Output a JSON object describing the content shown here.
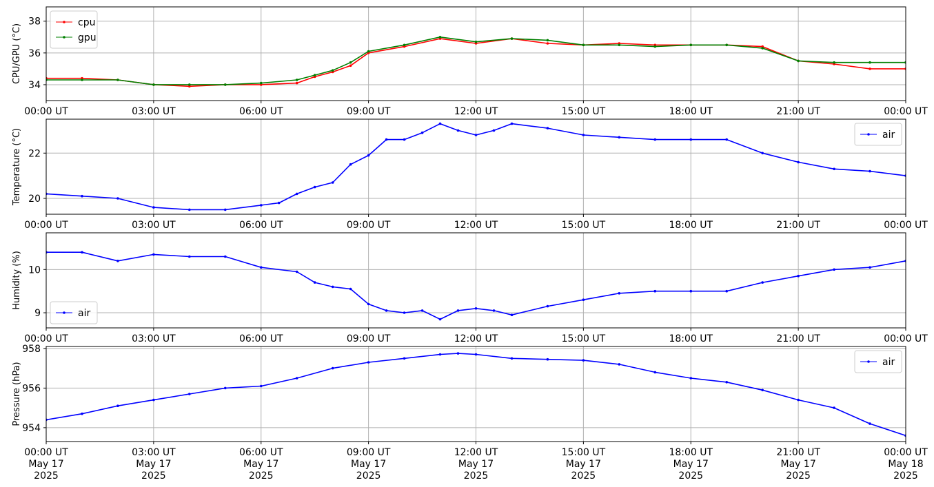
{
  "x_ticks": [
    {
      "time": "00:00 UT",
      "month_day": "May 17",
      "year": "2025"
    },
    {
      "time": "03:00 UT",
      "month_day": "May 17",
      "year": "2025"
    },
    {
      "time": "06:00 UT",
      "month_day": "May 17",
      "year": "2025"
    },
    {
      "time": "09:00 UT",
      "month_day": "May 17",
      "year": "2025"
    },
    {
      "time": "12:00 UT",
      "month_day": "May 17",
      "year": "2025"
    },
    {
      "time": "15:00 UT",
      "month_day": "May 17",
      "year": "2025"
    },
    {
      "time": "18:00 UT",
      "month_day": "May 17",
      "year": "2025"
    },
    {
      "time": "21:00 UT",
      "month_day": "May 17",
      "year": "2025"
    },
    {
      "time": "00:00 UT",
      "month_day": "May 18",
      "year": "2025"
    }
  ],
  "colors": {
    "cpu": "#ff0000",
    "gpu": "#008000",
    "air": "#0000ff"
  },
  "chart_data": [
    {
      "type": "line",
      "ylabel": "CPU/GPU (°C)",
      "ylim": [
        33.0,
        38.9
      ],
      "yticks": [
        34,
        36,
        38
      ],
      "xlim": [
        "2025-05-17 00:00",
        "2025-05-18 00:00"
      ],
      "grid": true,
      "legend": "top-left",
      "x": [
        "2025-05-17 00:00",
        "2025-05-17 01:00",
        "2025-05-17 02:00",
        "2025-05-17 03:00",
        "2025-05-17 04:00",
        "2025-05-17 05:00",
        "2025-05-17 06:00",
        "2025-05-17 07:00",
        "2025-05-17 07:30",
        "2025-05-17 08:00",
        "2025-05-17 08:30",
        "2025-05-17 09:00",
        "2025-05-17 10:00",
        "2025-05-17 11:00",
        "2025-05-17 12:00",
        "2025-05-17 13:00",
        "2025-05-17 14:00",
        "2025-05-17 15:00",
        "2025-05-17 16:00",
        "2025-05-17 17:00",
        "2025-05-17 18:00",
        "2025-05-17 19:00",
        "2025-05-17 20:00",
        "2025-05-17 21:00",
        "2025-05-17 22:00",
        "2025-05-17 23:00",
        "2025-05-18 00:00"
      ],
      "series": [
        {
          "name": "cpu",
          "color": "#ff0000",
          "values": [
            34.4,
            34.4,
            34.3,
            34.0,
            33.9,
            34.0,
            34.0,
            34.1,
            34.5,
            34.8,
            35.2,
            36.0,
            36.4,
            36.9,
            36.6,
            36.9,
            36.6,
            36.5,
            36.6,
            36.5,
            36.5,
            36.5,
            36.4,
            35.5,
            35.3,
            35.0,
            35.0
          ]
        },
        {
          "name": "gpu",
          "color": "#008000",
          "values": [
            34.3,
            34.3,
            34.3,
            34.0,
            34.0,
            34.0,
            34.1,
            34.3,
            34.6,
            34.9,
            35.4,
            36.1,
            36.5,
            37.0,
            36.7,
            36.9,
            36.8,
            36.5,
            36.5,
            36.4,
            36.5,
            36.5,
            36.3,
            35.5,
            35.4,
            35.4,
            35.4
          ]
        }
      ]
    },
    {
      "type": "line",
      "ylabel": "Temperature (°C)",
      "ylim": [
        19.3,
        23.5
      ],
      "yticks": [
        20,
        22
      ],
      "xlim": [
        "2025-05-17 00:00",
        "2025-05-18 00:00"
      ],
      "grid": true,
      "legend": "top-right",
      "x": [
        "2025-05-17 00:00",
        "2025-05-17 01:00",
        "2025-05-17 02:00",
        "2025-05-17 03:00",
        "2025-05-17 04:00",
        "2025-05-17 05:00",
        "2025-05-17 06:00",
        "2025-05-17 06:30",
        "2025-05-17 07:00",
        "2025-05-17 07:30",
        "2025-05-17 08:00",
        "2025-05-17 08:30",
        "2025-05-17 09:00",
        "2025-05-17 09:30",
        "2025-05-17 10:00",
        "2025-05-17 10:30",
        "2025-05-17 11:00",
        "2025-05-17 11:30",
        "2025-05-17 12:00",
        "2025-05-17 12:30",
        "2025-05-17 13:00",
        "2025-05-17 14:00",
        "2025-05-17 15:00",
        "2025-05-17 16:00",
        "2025-05-17 17:00",
        "2025-05-17 18:00",
        "2025-05-17 19:00",
        "2025-05-17 20:00",
        "2025-05-17 21:00",
        "2025-05-17 22:00",
        "2025-05-17 23:00",
        "2025-05-18 00:00"
      ],
      "series": [
        {
          "name": "air",
          "color": "#0000ff",
          "values": [
            20.2,
            20.1,
            20.0,
            19.6,
            19.5,
            19.5,
            19.7,
            19.8,
            20.2,
            20.5,
            20.7,
            21.5,
            21.9,
            22.6,
            22.6,
            22.9,
            23.3,
            23.0,
            22.8,
            23.0,
            23.3,
            23.1,
            22.8,
            22.7,
            22.6,
            22.6,
            22.6,
            22.0,
            21.6,
            21.3,
            21.2,
            21.0
          ]
        }
      ]
    },
    {
      "type": "line",
      "ylabel": "Humidity (%)",
      "ylim": [
        8.65,
        10.85
      ],
      "yticks": [
        9,
        10
      ],
      "xlim": [
        "2025-05-17 00:00",
        "2025-05-18 00:00"
      ],
      "grid": true,
      "legend": "bottom-left",
      "x": [
        "2025-05-17 00:00",
        "2025-05-17 01:00",
        "2025-05-17 02:00",
        "2025-05-17 03:00",
        "2025-05-17 04:00",
        "2025-05-17 05:00",
        "2025-05-17 06:00",
        "2025-05-17 07:00",
        "2025-05-17 07:30",
        "2025-05-17 08:00",
        "2025-05-17 08:30",
        "2025-05-17 09:00",
        "2025-05-17 09:30",
        "2025-05-17 10:00",
        "2025-05-17 10:30",
        "2025-05-17 11:00",
        "2025-05-17 11:30",
        "2025-05-17 12:00",
        "2025-05-17 12:30",
        "2025-05-17 13:00",
        "2025-05-17 14:00",
        "2025-05-17 15:00",
        "2025-05-17 16:00",
        "2025-05-17 17:00",
        "2025-05-17 18:00",
        "2025-05-17 19:00",
        "2025-05-17 20:00",
        "2025-05-17 21:00",
        "2025-05-17 22:00",
        "2025-05-17 23:00",
        "2025-05-18 00:00"
      ],
      "series": [
        {
          "name": "air",
          "color": "#0000ff",
          "values": [
            10.4,
            10.4,
            10.2,
            10.35,
            10.3,
            10.3,
            10.05,
            9.95,
            9.7,
            9.6,
            9.55,
            9.2,
            9.05,
            9.0,
            9.05,
            8.85,
            9.05,
            9.1,
            9.05,
            8.95,
            9.15,
            9.3,
            9.45,
            9.5,
            9.5,
            9.5,
            9.7,
            9.85,
            10.0,
            10.05,
            10.2
          ]
        }
      ]
    },
    {
      "type": "line",
      "ylabel": "Pressure (hPa)",
      "ylim": [
        953.3,
        958.1
      ],
      "yticks": [
        954,
        956,
        958
      ],
      "xlim": [
        "2025-05-17 00:00",
        "2025-05-18 00:00"
      ],
      "grid": true,
      "legend": "top-right",
      "x": [
        "2025-05-17 00:00",
        "2025-05-17 01:00",
        "2025-05-17 02:00",
        "2025-05-17 03:00",
        "2025-05-17 04:00",
        "2025-05-17 05:00",
        "2025-05-17 06:00",
        "2025-05-17 07:00",
        "2025-05-17 08:00",
        "2025-05-17 09:00",
        "2025-05-17 10:00",
        "2025-05-17 11:00",
        "2025-05-17 11:30",
        "2025-05-17 12:00",
        "2025-05-17 13:00",
        "2025-05-17 14:00",
        "2025-05-17 15:00",
        "2025-05-17 16:00",
        "2025-05-17 17:00",
        "2025-05-17 18:00",
        "2025-05-17 19:00",
        "2025-05-17 20:00",
        "2025-05-17 21:00",
        "2025-05-17 22:00",
        "2025-05-17 23:00",
        "2025-05-18 00:00"
      ],
      "series": [
        {
          "name": "air",
          "color": "#0000ff",
          "values": [
            954.4,
            954.7,
            955.1,
            955.4,
            955.7,
            956.0,
            956.1,
            956.5,
            957.0,
            957.3,
            957.5,
            957.7,
            957.75,
            957.7,
            957.5,
            957.45,
            957.4,
            957.2,
            956.8,
            956.5,
            956.3,
            955.9,
            955.4,
            955.0,
            954.2,
            953.6
          ]
        }
      ]
    }
  ]
}
